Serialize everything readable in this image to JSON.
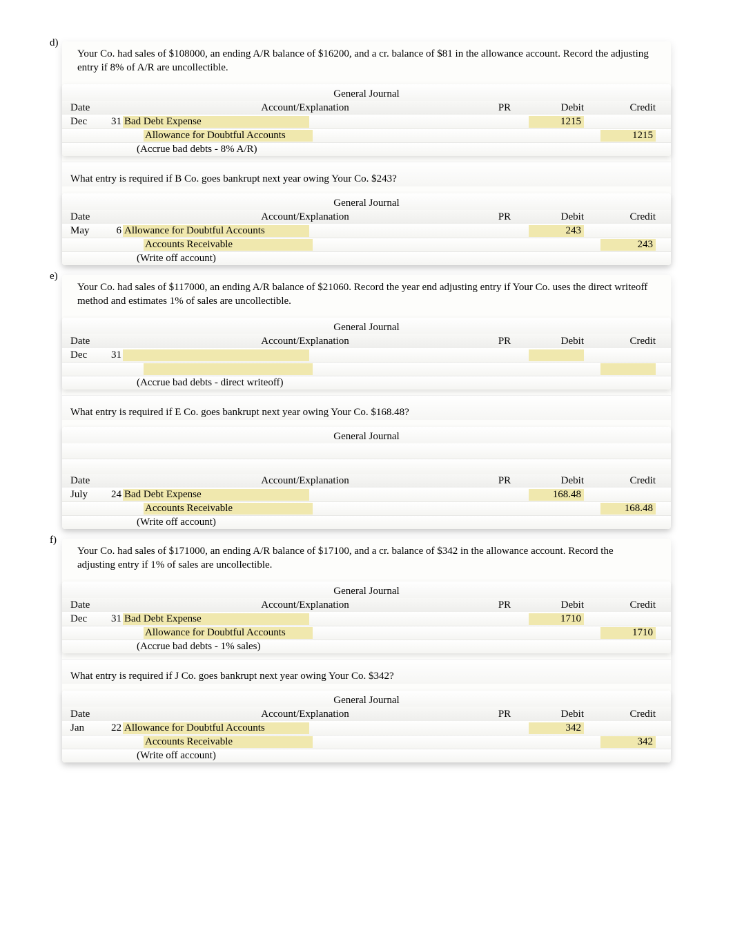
{
  "journal_title": "General Journal",
  "headers": {
    "date": "Date",
    "acct": "Account/Explanation",
    "pr": "PR",
    "debit": "Debit",
    "credit": "Credit"
  },
  "problems": [
    {
      "letter": "d)",
      "prompt": "Your Co. had sales of $108000, an ending A/R balance of $16200, and a cr.  balance of $81 in the allowance account.   Record the adjusting entry if 8% of A/R are uncollectible.",
      "j1": {
        "rows": [
          {
            "month": "Dec",
            "day": "31",
            "acct": "Bad Debt Expense",
            "indent": 1,
            "ans": true,
            "pr": "",
            "debit": "1215",
            "credit": ""
          },
          {
            "month": "",
            "day": "",
            "acct": "Allowance for Doubtful Accounts",
            "indent": 2,
            "ans": true,
            "pr": "",
            "debit": "",
            "credit": "1215"
          },
          {
            "month": "",
            "day": "",
            "acct": "(Accrue bad debts - 8% A/R)",
            "indent": "memo",
            "ans": false,
            "pr": "",
            "debit": "",
            "credit": ""
          }
        ]
      },
      "subq": "What entry is required if B Co. goes bankrupt next year owing Your Co. $243?",
      "j2": {
        "rows": [
          {
            "month": "May",
            "day": "6",
            "acct": "Allowance for Doubtful Accounts",
            "indent": 1,
            "ans": true,
            "pr": "",
            "debit": "243",
            "credit": ""
          },
          {
            "month": "",
            "day": "",
            "acct": "Accounts Receivable",
            "indent": 2,
            "ans": true,
            "pr": "",
            "debit": "",
            "credit": "243"
          },
          {
            "month": "",
            "day": "",
            "acct": "(Write off account)",
            "indent": "memo",
            "ans": false,
            "pr": "",
            "debit": "",
            "credit": ""
          }
        ]
      }
    },
    {
      "letter": "e)",
      "prompt": "Your Co. had sales of $117000, an ending A/R balance of $21060. Record the year end adjusting entry if Your Co. uses the direct writeoff method and estimates 1% of sales are uncollectible.",
      "j1": {
        "rows": [
          {
            "month": "Dec",
            "day": "31",
            "acct": "",
            "indent": 1,
            "ans": true,
            "pr": "",
            "debit": "",
            "credit": "",
            "blank": true
          },
          {
            "month": "",
            "day": "",
            "acct": "",
            "indent": 2,
            "ans": true,
            "pr": "",
            "debit": "",
            "credit": "",
            "blank": true
          },
          {
            "month": "",
            "day": "",
            "acct": "(Accrue bad debts - direct writeoff)",
            "indent": "memo",
            "ans": false,
            "pr": "",
            "debit": "",
            "credit": ""
          }
        ]
      },
      "subq": "What entry is required if E Co. goes bankrupt next year owing Your Co. $168.48?",
      "j2_has_header_pad": true,
      "j2": {
        "rows": [
          {
            "month": "July",
            "day": "24",
            "acct": "Bad Debt Expense",
            "indent": 1,
            "ans": true,
            "pr": "",
            "debit": "168.48",
            "credit": ""
          },
          {
            "month": "",
            "day": "",
            "acct": "Accounts Receivable",
            "indent": 2,
            "ans": true,
            "pr": "",
            "debit": "",
            "credit": "168.48"
          },
          {
            "month": "",
            "day": "",
            "acct": "(Write off account)",
            "indent": "memo",
            "ans": false,
            "pr": "",
            "debit": "",
            "credit": ""
          }
        ]
      }
    },
    {
      "letter": "f)",
      "prompt": "Your Co. had sales of $171000, an ending A/R balance of $17100, and a cr.  balance of $342 in the allowance account.   Record the adjusting entry if 1% of sales are uncollectible.",
      "j1": {
        "rows": [
          {
            "month": "Dec",
            "day": "31",
            "acct": "Bad Debt Expense",
            "indent": 1,
            "ans": true,
            "pr": "",
            "debit": "1710",
            "credit": ""
          },
          {
            "month": "",
            "day": "",
            "acct": "Allowance for Doubtful Accounts",
            "indent": 2,
            "ans": true,
            "pr": "",
            "debit": "",
            "credit": "1710"
          },
          {
            "month": "",
            "day": "",
            "acct": "(Accrue bad debts - 1% sales)",
            "indent": "memo",
            "ans": false,
            "pr": "",
            "debit": "",
            "credit": ""
          }
        ]
      },
      "subq": "What entry is required if J Co. goes bankrupt next year owing Your Co. $342?",
      "j2": {
        "rows": [
          {
            "month": "Jan",
            "day": "22",
            "acct": "Allowance for Doubtful Accounts",
            "indent": 1,
            "ans": true,
            "pr": "",
            "debit": "342",
            "credit": ""
          },
          {
            "month": "",
            "day": "",
            "acct": "Accounts Receivable",
            "indent": 2,
            "ans": true,
            "pr": "",
            "debit": "",
            "credit": "342"
          },
          {
            "month": "",
            "day": "",
            "acct": "(Write off account)",
            "indent": "memo",
            "ans": false,
            "pr": "",
            "debit": "",
            "credit": ""
          }
        ]
      }
    }
  ]
}
